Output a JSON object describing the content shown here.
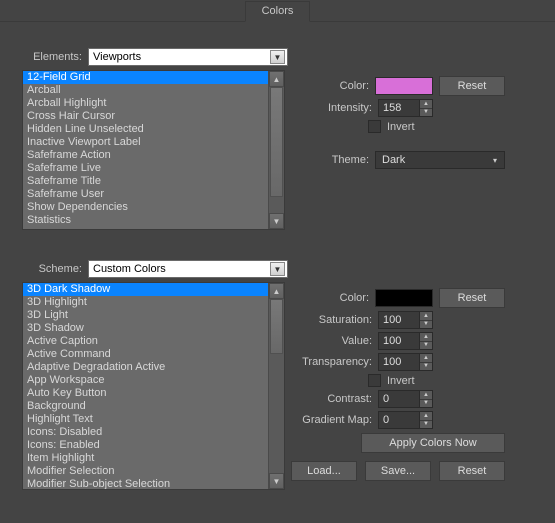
{
  "tab": {
    "colors": "Colors"
  },
  "elements": {
    "label": "Elements:",
    "dropdown": "Viewports",
    "items": [
      "12-Field Grid",
      "Arcball",
      "Arcball Highlight",
      "Cross Hair Cursor",
      "Hidden Line Unselected",
      "Inactive Viewport Label",
      "Safeframe Action",
      "Safeframe Live",
      "Safeframe Title",
      "Safeframe User",
      "Show Dependencies",
      "Statistics"
    ],
    "selected": "12-Field Grid"
  },
  "elements_controls": {
    "color_label": "Color:",
    "color_hex": "#d86fd8",
    "reset": "Reset",
    "intensity_label": "Intensity:",
    "intensity_value": "158",
    "invert_label": "Invert",
    "theme_label": "Theme:",
    "theme_value": "Dark"
  },
  "scheme": {
    "label": "Scheme:",
    "dropdown": "Custom Colors",
    "items": [
      "3D Dark Shadow",
      "3D Highlight",
      "3D Light",
      "3D Shadow",
      "Active Caption",
      "Active Command",
      "Adaptive Degradation Active",
      "App Workspace",
      "Auto Key Button",
      "Background",
      "Highlight Text",
      "Icons: Disabled",
      "Icons: Enabled",
      "Item Highlight",
      "Modifier Selection",
      "Modifier Sub-object Selection"
    ],
    "selected": "3D Dark Shadow"
  },
  "scheme_controls": {
    "color_label": "Color:",
    "color_hex": "#000000",
    "reset": "Reset",
    "saturation_label": "Saturation:",
    "saturation_value": "100",
    "value_label": "Value:",
    "value_value": "100",
    "transparency_label": "Transparency:",
    "transparency_value": "100",
    "invert_label": "Invert",
    "contrast_label": "Contrast:",
    "contrast_value": "0",
    "gradient_label": "Gradient Map:",
    "gradient_value": "0",
    "apply": "Apply Colors Now"
  },
  "bottom": {
    "load": "Load...",
    "save": "Save...",
    "reset": "Reset"
  }
}
